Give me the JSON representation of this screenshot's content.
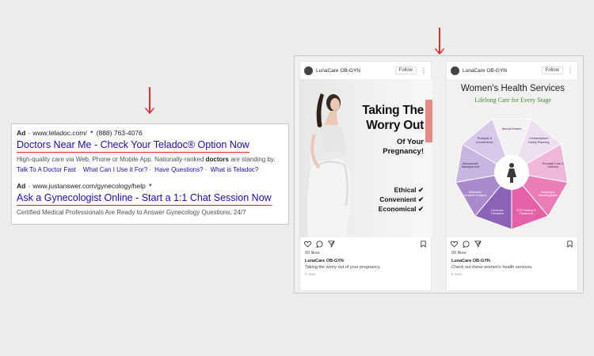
{
  "ads": [
    {
      "badge": "Ad",
      "url": "www.teladoc.com/",
      "phone": "(888) 763-4076",
      "title": "Doctors Near Me - Check Your Teladoc® Option Now",
      "desc_pre": "High-quality care via Web, Phone or Mobile App. Nationally-ranked ",
      "desc_bold": "doctors",
      "desc_post": " are standing by.",
      "links": [
        "Talk To A Doctor Fast",
        "What Can I Use it For?",
        "Have Questions?",
        "What is Teladoc?"
      ],
      "link_sep": "·"
    },
    {
      "badge": "Ad",
      "url": "www.justanswer.com/gynecology/help",
      "title": "Ask a Gynecologist Online - Start a 1:1 Chat Session Now",
      "desc": "Certified Medical Professionals Are Ready to Answer Gynecology Questions, 24/7"
    }
  ],
  "posts": [
    {
      "account": "LunaCare OB-GYN",
      "follow_label": "Follow",
      "more": "⋮",
      "image": {
        "title_lines": [
          "Taking The",
          "Worry Out"
        ],
        "sub_lines": [
          "Of Your",
          "Pregnancy!"
        ],
        "list": [
          "Ethical ✔",
          "Convenient ✔",
          "Economical ✔"
        ]
      },
      "likes": "99 likes",
      "username": "LunaCare OB-GYN",
      "caption": "Taking the worry out of your pregnancy.",
      "date": "5 June"
    },
    {
      "account": "LunaCare OB-GYN",
      "follow_label": "Follow",
      "more": "⋮",
      "image": {
        "title": "Women's Health Services",
        "subtitle": "Lifelong Care for Every Stage",
        "segments": [
          "Annual Exams",
          "Contraception/ Family Planning",
          "Prenatal Care & Delivery",
          "Imaging & Mammograms",
          "STD Testing & Treatment",
          "Hormone Therapies",
          "Minimally Invasive Surgery",
          "Menopause Management",
          "Prolapse & Incontinence"
        ]
      },
      "likes": "99 likes",
      "username": "LunaCare OB-GYN",
      "caption": "Check out these women's health services.",
      "date": "5 June"
    }
  ],
  "colors": {
    "arrow": "#e02a2a",
    "ad_link": "#1a0dab",
    "wheel": [
      "#f4f1f5",
      "#eedff0",
      "#f0b7d8",
      "#ea7db8",
      "#e361a4",
      "#8a63b8",
      "#a98bcc",
      "#c7b7e0",
      "#d8c8ea"
    ]
  }
}
